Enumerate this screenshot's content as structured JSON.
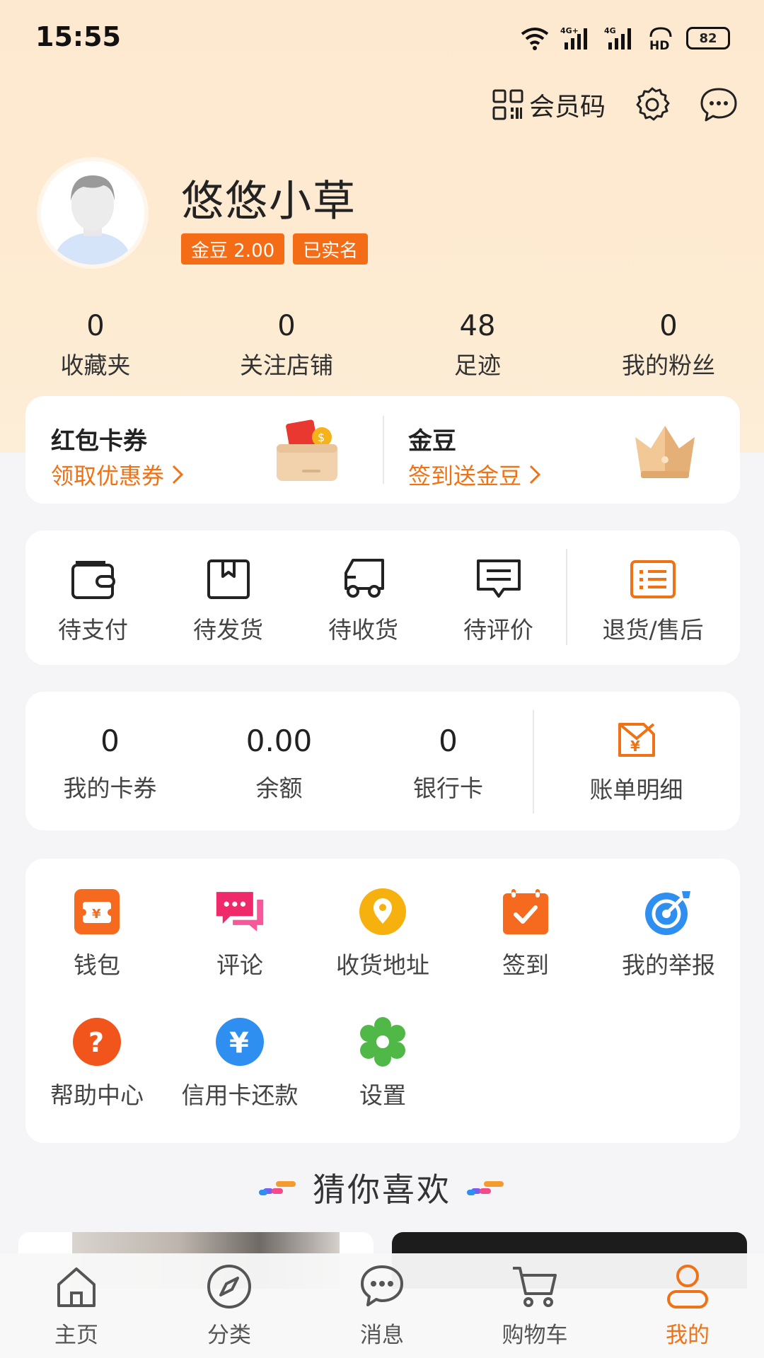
{
  "status_bar": {
    "time": "15:55",
    "battery": "82",
    "net1": "4G+",
    "net2": "4G",
    "hd": "HD"
  },
  "top_actions": {
    "member_code_label": "会员码"
  },
  "profile": {
    "name": "悠悠小草",
    "badges": [
      {
        "label": "金豆 2.00"
      },
      {
        "label": "已实名"
      }
    ]
  },
  "stats": [
    {
      "value": "0",
      "label": "收藏夹"
    },
    {
      "value": "0",
      "label": "关注店铺"
    },
    {
      "value": "48",
      "label": "足迹"
    },
    {
      "value": "0",
      "label": "我的粉丝"
    }
  ],
  "promo": {
    "left": {
      "title": "红包卡券",
      "link": "领取优惠券"
    },
    "right": {
      "title": "金豆",
      "link": "签到送金豆"
    }
  },
  "orders": [
    {
      "label": "待支付",
      "icon": "wallet-icon"
    },
    {
      "label": "待发货",
      "icon": "box-icon"
    },
    {
      "label": "待收货",
      "icon": "truck-icon"
    },
    {
      "label": "待评价",
      "icon": "comment-icon"
    },
    {
      "label": "退货/售后",
      "icon": "list-icon"
    }
  ],
  "wallet": [
    {
      "value": "0",
      "label": "我的卡券"
    },
    {
      "value": "0.00",
      "label": "余额"
    },
    {
      "value": "0",
      "label": "银行卡"
    },
    {
      "label": "账单明细",
      "icon": "bill-icon"
    }
  ],
  "services": [
    {
      "label": "钱包",
      "icon": "wallet-ticket-icon",
      "color": "#f56a1e"
    },
    {
      "label": "评论",
      "icon": "chat-bubbles-icon",
      "color": "#ee2a6a"
    },
    {
      "label": "收货地址",
      "icon": "location-pin-icon",
      "color": "#f7b10f"
    },
    {
      "label": "签到",
      "icon": "calendar-check-icon",
      "color": "#f56a1e"
    },
    {
      "label": "我的举报",
      "icon": "target-icon",
      "color": "#2f8ff0"
    },
    {
      "label": "帮助中心",
      "icon": "question-icon",
      "color": "#f2551c"
    },
    {
      "label": "信用卡还款",
      "icon": "yen-coin-icon",
      "color": "#2f8ff0"
    },
    {
      "label": "设置",
      "icon": "settings-flower-icon",
      "color": "#4fb847"
    }
  ],
  "recommend": {
    "title": "猜你喜欢"
  },
  "tabbar": [
    {
      "label": "主页",
      "icon": "home-icon"
    },
    {
      "label": "分类",
      "icon": "compass-icon"
    },
    {
      "label": "消息",
      "icon": "message-icon"
    },
    {
      "label": "购物车",
      "icon": "cart-icon"
    },
    {
      "label": "我的",
      "icon": "user-icon",
      "active": true
    }
  ],
  "colors": {
    "accent": "#f07216",
    "badge": "#f46d16",
    "hero_bg": "#fde9cf"
  }
}
